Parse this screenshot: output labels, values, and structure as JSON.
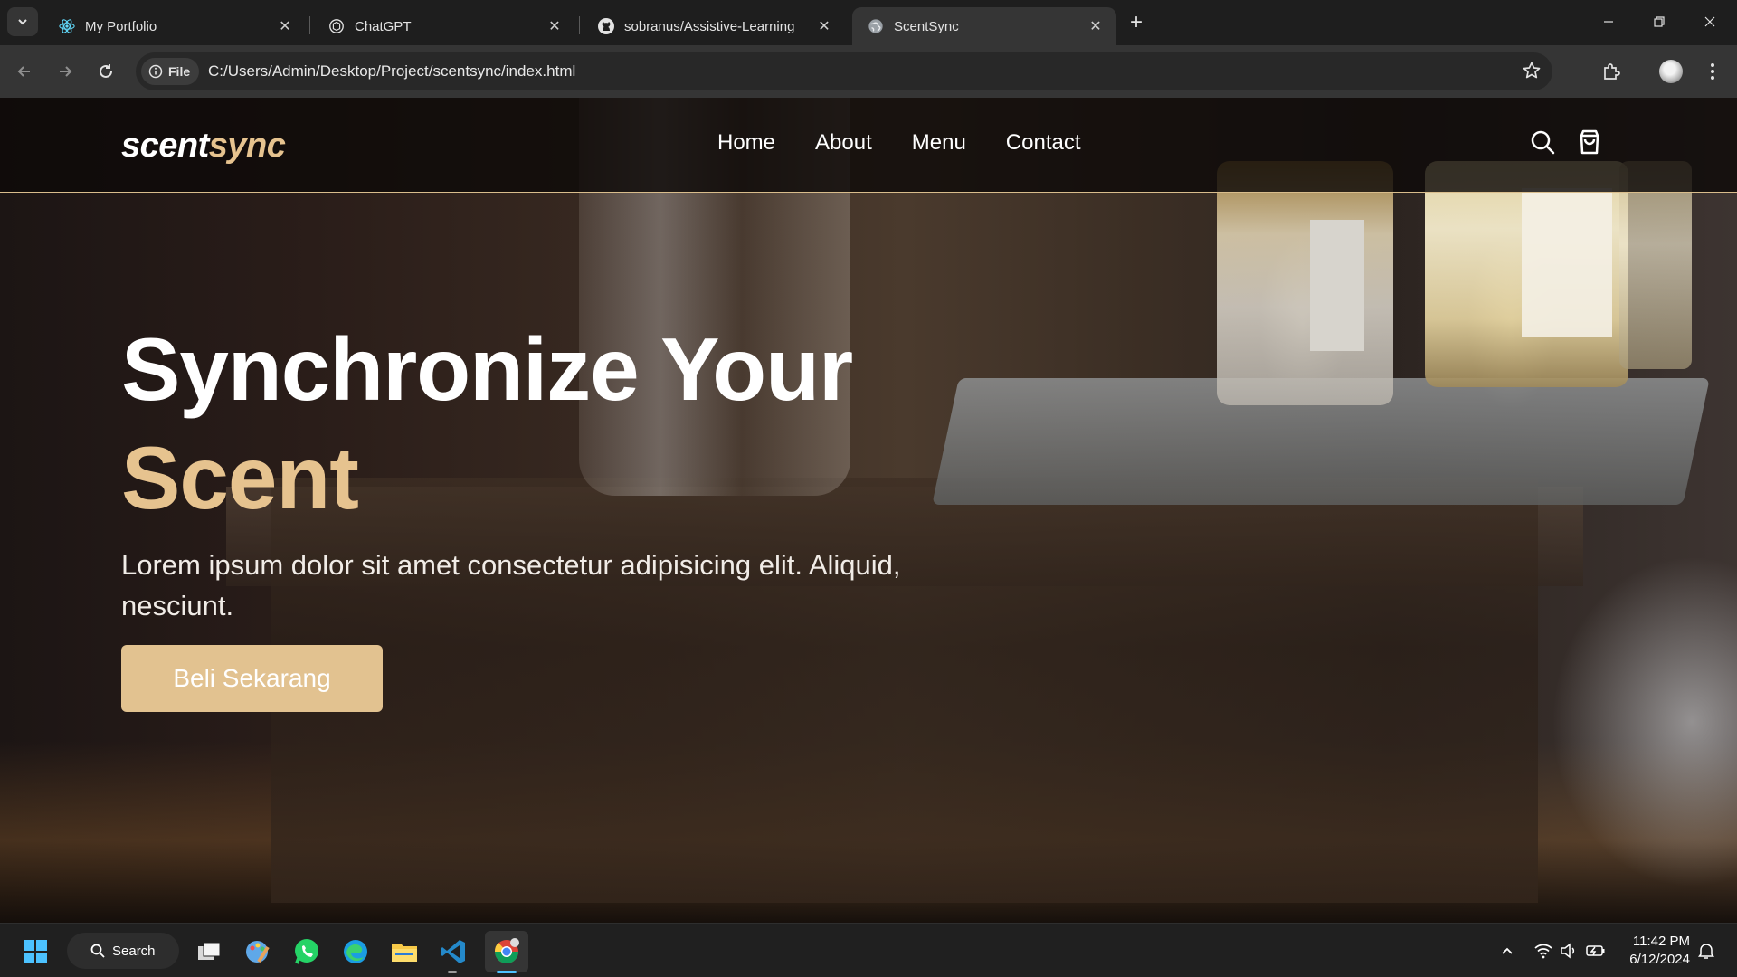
{
  "browser": {
    "tabs": [
      {
        "title": "My Portfolio",
        "favicon": "react-icon",
        "active": false
      },
      {
        "title": "ChatGPT",
        "favicon": "chatgpt-icon",
        "active": false
      },
      {
        "title": "sobranus/Assistive-Learning",
        "favicon": "github-icon",
        "active": false
      },
      {
        "title": "ScentSync",
        "favicon": "globe-icon",
        "active": true
      }
    ],
    "address_chip": "File",
    "url": "C:/Users/Admin/Desktop/Project/scentsync/index.html"
  },
  "site": {
    "logo_main": "scent",
    "logo_accent": "sync",
    "nav": [
      "Home",
      "About",
      "Menu",
      "Contact"
    ],
    "hero_line1": "Synchronize Your",
    "hero_line2": "Scent",
    "hero_text": "Lorem ipsum dolor sit amet consectetur adipisicing elit. Aliquid, nesciunt.",
    "cta": "Beli Sekarang",
    "colors": {
      "accent": "#e6c38f",
      "button": "#e2c290",
      "nav_bg": "#0e0a09"
    }
  },
  "taskbar": {
    "search_label": "Search",
    "apps": [
      "task-view-icon",
      "paint-icon",
      "whatsapp-icon",
      "edge-icon",
      "file-explorer-icon",
      "vscode-icon",
      "chrome-icon"
    ],
    "time": "11:42 PM",
    "date": "6/12/2024"
  }
}
